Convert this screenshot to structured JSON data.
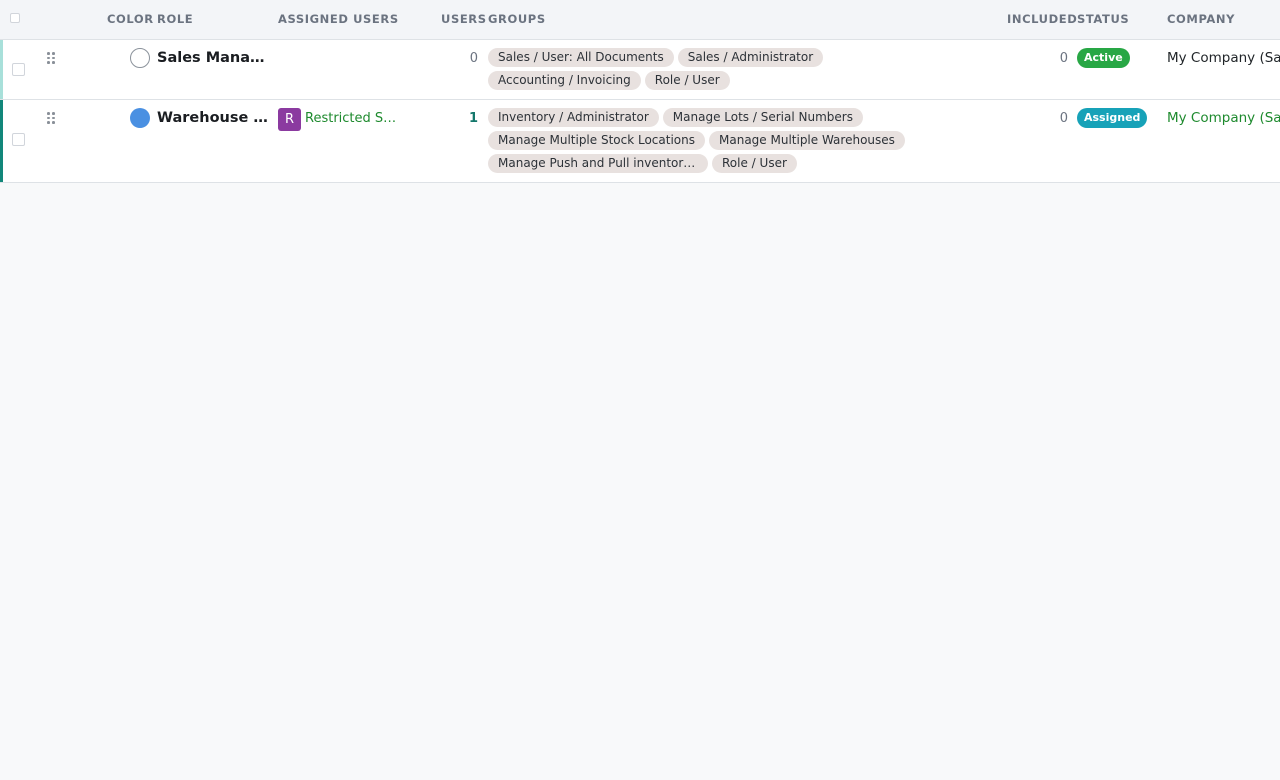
{
  "headers": {
    "color": "COLOR",
    "role": "ROLE",
    "assigned_users": "ASSIGNED USERS",
    "users": "USERS",
    "groups": "GROUPS",
    "included": "INCLUDED",
    "status": "STATUS",
    "company": "COMPANY"
  },
  "rows": [
    {
      "color": "none",
      "role": "Sales Manager",
      "assigned_user_initial": "",
      "assigned_user_name": "",
      "users": "0",
      "groups": [
        "Sales / User: All Documents",
        "Sales / Administrator",
        "Accounting / Invoicing",
        "Role / User"
      ],
      "included": "0",
      "status": "Active",
      "status_color": "#28a745",
      "company": "My Company (San"
    },
    {
      "color": "#4a90e2",
      "role": "Warehouse M…",
      "assigned_user_initial": "R",
      "assigned_user_name": "Restricted Sa…",
      "users": "1",
      "groups": [
        "Inventory / Administrator",
        "Manage Lots / Serial Numbers",
        "Manage Multiple Stock Locations",
        "Manage Multiple Warehouses",
        "Manage Push and Pull inventory fl…",
        "Role / User"
      ],
      "included": "0",
      "status": "Assigned",
      "status_color": "#17a2b8",
      "company": "My Company (San"
    }
  ]
}
